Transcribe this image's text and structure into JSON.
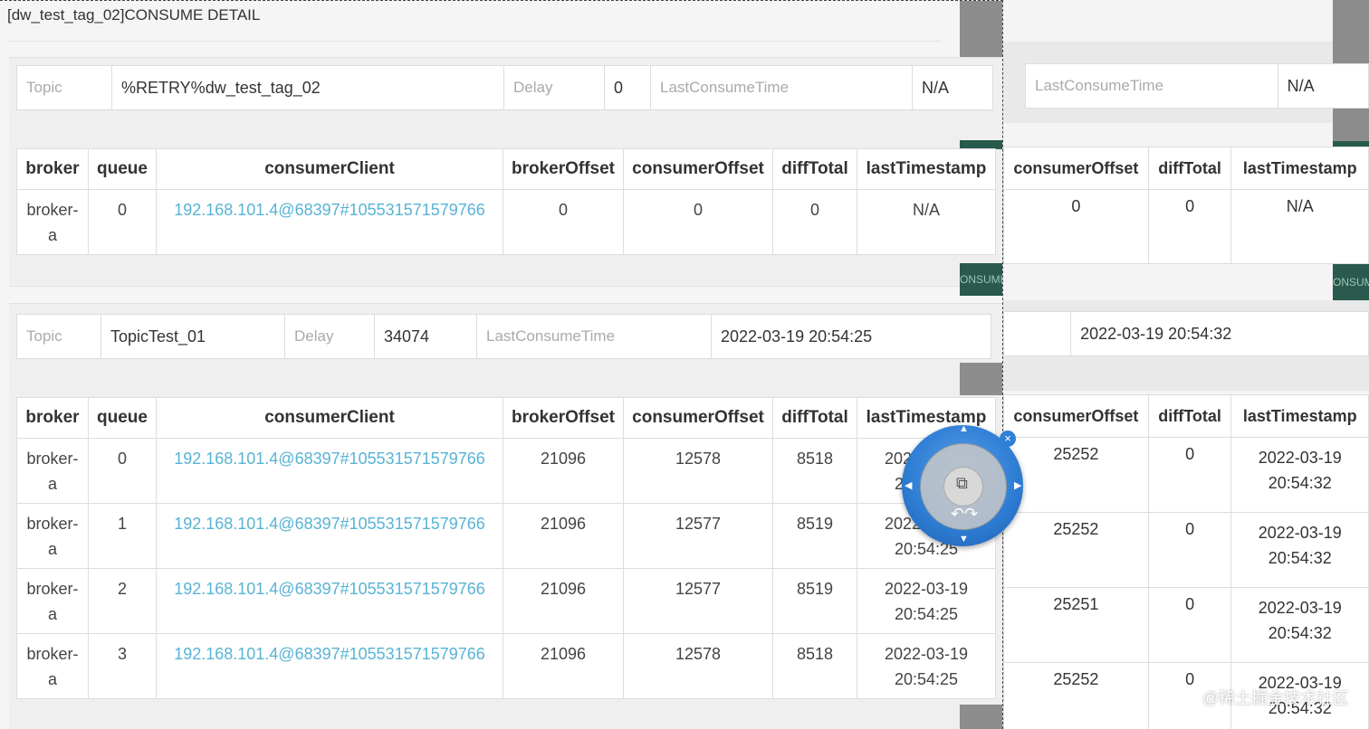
{
  "modal": {
    "title": "[dw_test_tag_02]CONSUME DETAIL"
  },
  "labels": {
    "topic": "Topic",
    "delay": "Delay",
    "last_consume_time": "LastConsumeTime",
    "consume_tab": "ONSUME"
  },
  "columns": [
    "broker",
    "queue",
    "consumerClient",
    "brokerOffset",
    "consumerOffset",
    "diffTotal",
    "lastTimestamp"
  ],
  "groups": [
    {
      "topic": "%RETRY%dw_test_tag_02",
      "delay": "0",
      "last_consume_time": "N/A",
      "rows": [
        {
          "broker": "broker-a",
          "queue": "0",
          "client": "192.168.101.4@68397#105531571579766",
          "brokerOffset": "0",
          "consumerOffset": "0",
          "diffTotal": "0",
          "lastTimestamp": "N/A"
        }
      ]
    },
    {
      "topic": "TopicTest_01",
      "delay": "34074",
      "last_consume_time": "2022-03-19 20:54:25",
      "rows": [
        {
          "broker": "broker-a",
          "queue": "0",
          "client": "192.168.101.4@68397#105531571579766",
          "brokerOffset": "21096",
          "consumerOffset": "12578",
          "diffTotal": "8518",
          "lastTimestamp": "2022-03-19 20:54:25"
        },
        {
          "broker": "broker-a",
          "queue": "1",
          "client": "192.168.101.4@68397#105531571579766",
          "brokerOffset": "21096",
          "consumerOffset": "12577",
          "diffTotal": "8519",
          "lastTimestamp": "2022-03-19 20:54:25"
        },
        {
          "broker": "broker-a",
          "queue": "2",
          "client": "192.168.101.4@68397#105531571579766",
          "brokerOffset": "21096",
          "consumerOffset": "12577",
          "diffTotal": "8519",
          "lastTimestamp": "2022-03-19 20:54:25"
        },
        {
          "broker": "broker-a",
          "queue": "3",
          "client": "192.168.101.4@68397#105531571579766",
          "brokerOffset": "21096",
          "consumerOffset": "12578",
          "diffTotal": "8518",
          "lastTimestamp": "2022-03-19 20:54:25"
        }
      ]
    }
  ],
  "background": {
    "group1": {
      "last_consume_time": "N/A",
      "rows": [
        {
          "consumerOffset": "0",
          "diffTotal": "0",
          "lastTimestamp": "N/A"
        }
      ]
    },
    "group2": {
      "last_consume_time": "2022-03-19 20:54:32",
      "rows": [
        {
          "consumerOffset": "25252",
          "diffTotal": "0",
          "lastTimestamp": "2022-03-19 20:54:32"
        },
        {
          "consumerOffset": "25252",
          "diffTotal": "0",
          "lastTimestamp": "2022-03-19 20:54:32"
        },
        {
          "consumerOffset": "25251",
          "diffTotal": "0",
          "lastTimestamp": "2022-03-19 20:54:32"
        },
        {
          "consumerOffset": "25252",
          "diffTotal": "0",
          "lastTimestamp": "2022-03-19 20:54:32"
        }
      ]
    }
  },
  "nav_widget": {
    "icons": [
      "arrow-up-icon",
      "arrow-down-icon",
      "arrow-left-icon",
      "arrow-right-icon",
      "close-icon",
      "rotate-icon",
      "home-icon"
    ],
    "close_glyph": "×"
  },
  "watermark": "@稀土掘金技术社区"
}
